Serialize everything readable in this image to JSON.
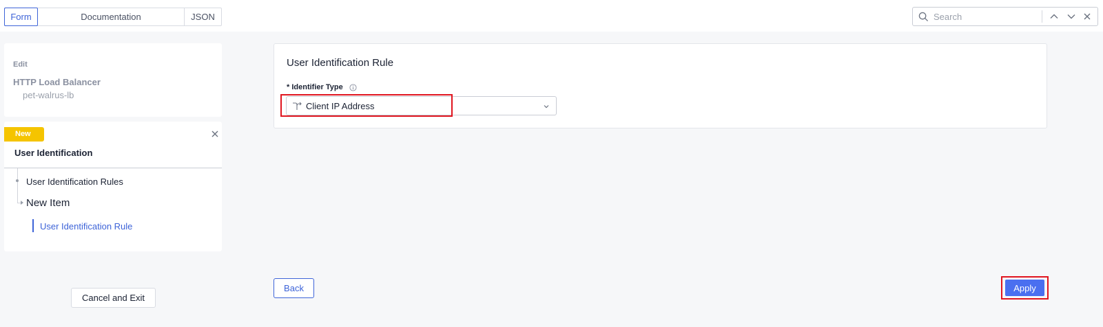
{
  "tabs": [
    {
      "label": "Form",
      "active": true
    },
    {
      "label": "Documentation",
      "active": false
    },
    {
      "label": "JSON",
      "active": false
    }
  ],
  "search": {
    "placeholder": "Search"
  },
  "sidebar": {
    "edit_label": "Edit",
    "object_type": "HTTP Load Balancer",
    "object_name": "pet-walrus-lb",
    "section": {
      "badge": "New",
      "title": "User Identification",
      "nav": {
        "rules": "User Identification Rules",
        "new_item": "New Item",
        "rule": "User Identification Rule"
      }
    },
    "cancel_label": "Cancel and Exit"
  },
  "form": {
    "title": "User Identification Rule",
    "field_label": "* Identifier Type",
    "field_value": "Client IP Address"
  },
  "footer": {
    "back_label": "Back",
    "apply_label": "Apply"
  },
  "colors": {
    "accent": "#3d63d8",
    "apply": "#4a6ff0",
    "badge": "#f5c400",
    "highlight": "#e0141e"
  }
}
